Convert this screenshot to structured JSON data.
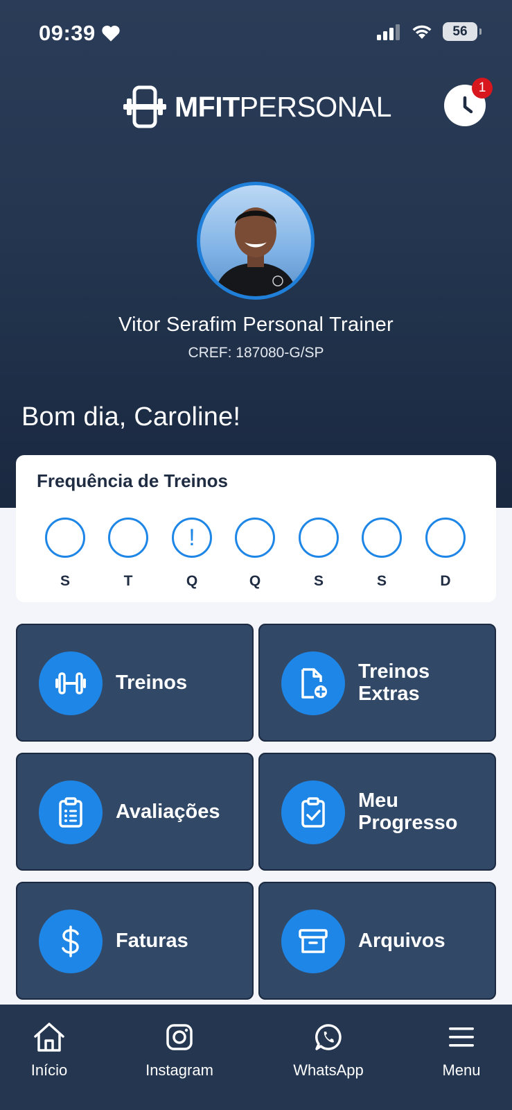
{
  "status_bar": {
    "time": "09:39",
    "battery": "56"
  },
  "header": {
    "logo_bold": "MFIT",
    "logo_regular": "PERSONAL",
    "notification_count": "1"
  },
  "trainer": {
    "name": "Vitor Serafim Personal Trainer",
    "cref": "CREF: 187080-G/SP"
  },
  "greeting": "Bom dia, Caroline!",
  "frequency": {
    "title": "Frequência de Treinos",
    "days": [
      {
        "letter": "S",
        "mark": ""
      },
      {
        "letter": "T",
        "mark": ""
      },
      {
        "letter": "Q",
        "mark": "!"
      },
      {
        "letter": "Q",
        "mark": ""
      },
      {
        "letter": "S",
        "mark": ""
      },
      {
        "letter": "S",
        "mark": ""
      },
      {
        "letter": "D",
        "mark": ""
      }
    ]
  },
  "tiles": [
    {
      "label": "Treinos",
      "icon": "dumbbell-icon"
    },
    {
      "label": "Treinos Extras",
      "icon": "file-plus-icon"
    },
    {
      "label": "Avaliações",
      "icon": "clipboard-list-icon"
    },
    {
      "label": "Meu Progresso",
      "icon": "clipboard-check-icon"
    },
    {
      "label": "Faturas",
      "icon": "dollar-icon"
    },
    {
      "label": "Arquivos",
      "icon": "archive-icon"
    }
  ],
  "bottom_nav": [
    {
      "label": "Início",
      "icon": "home-icon"
    },
    {
      "label": "Instagram",
      "icon": "instagram-icon"
    },
    {
      "label": "WhatsApp",
      "icon": "whatsapp-icon"
    },
    {
      "label": "Menu",
      "icon": "menu-icon"
    }
  ],
  "colors": {
    "header_bg": "#243650",
    "tile_bg": "#324867",
    "accent_blue": "#1e86e6",
    "badge_red": "#d8161e"
  }
}
